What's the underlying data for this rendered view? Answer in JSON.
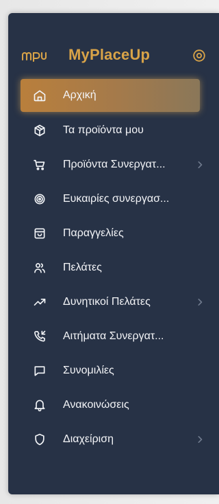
{
  "brand": {
    "logo_text": "mpu",
    "title": "MyPlaceUp"
  },
  "nav": {
    "items": [
      {
        "label": "Αρχική"
      },
      {
        "label": "Τα προϊόντα μου"
      },
      {
        "label": "Προϊόντα Συνεργατ..."
      },
      {
        "label": "Ευκαιρίες συνεργασ..."
      },
      {
        "label": "Παραγγελίες"
      },
      {
        "label": "Πελάτες"
      },
      {
        "label": "Δυνητικοί Πελάτες"
      },
      {
        "label": "Αιτήματα Συνεργατ..."
      },
      {
        "label": "Συνομιλίες"
      },
      {
        "label": "Ανακοινώσεις"
      },
      {
        "label": "Διαχείριση"
      }
    ]
  },
  "colors": {
    "sidebar_bg": "#273246",
    "accent": "#d8a348",
    "active_bg": "#b97f3c",
    "text": "#f3f4f7",
    "chevron": "#6f7a8d"
  },
  "icons": {
    "home": "home-icon",
    "box": "box-icon",
    "cart": "shopping-cart-icon",
    "target": "target-icon",
    "orders": "orders-icon",
    "customers": "users-icon",
    "trend": "trend-up-icon",
    "phone": "phone-incoming-icon",
    "chat": "chat-icon",
    "bell": "bell-icon",
    "shield": "shield-icon"
  }
}
